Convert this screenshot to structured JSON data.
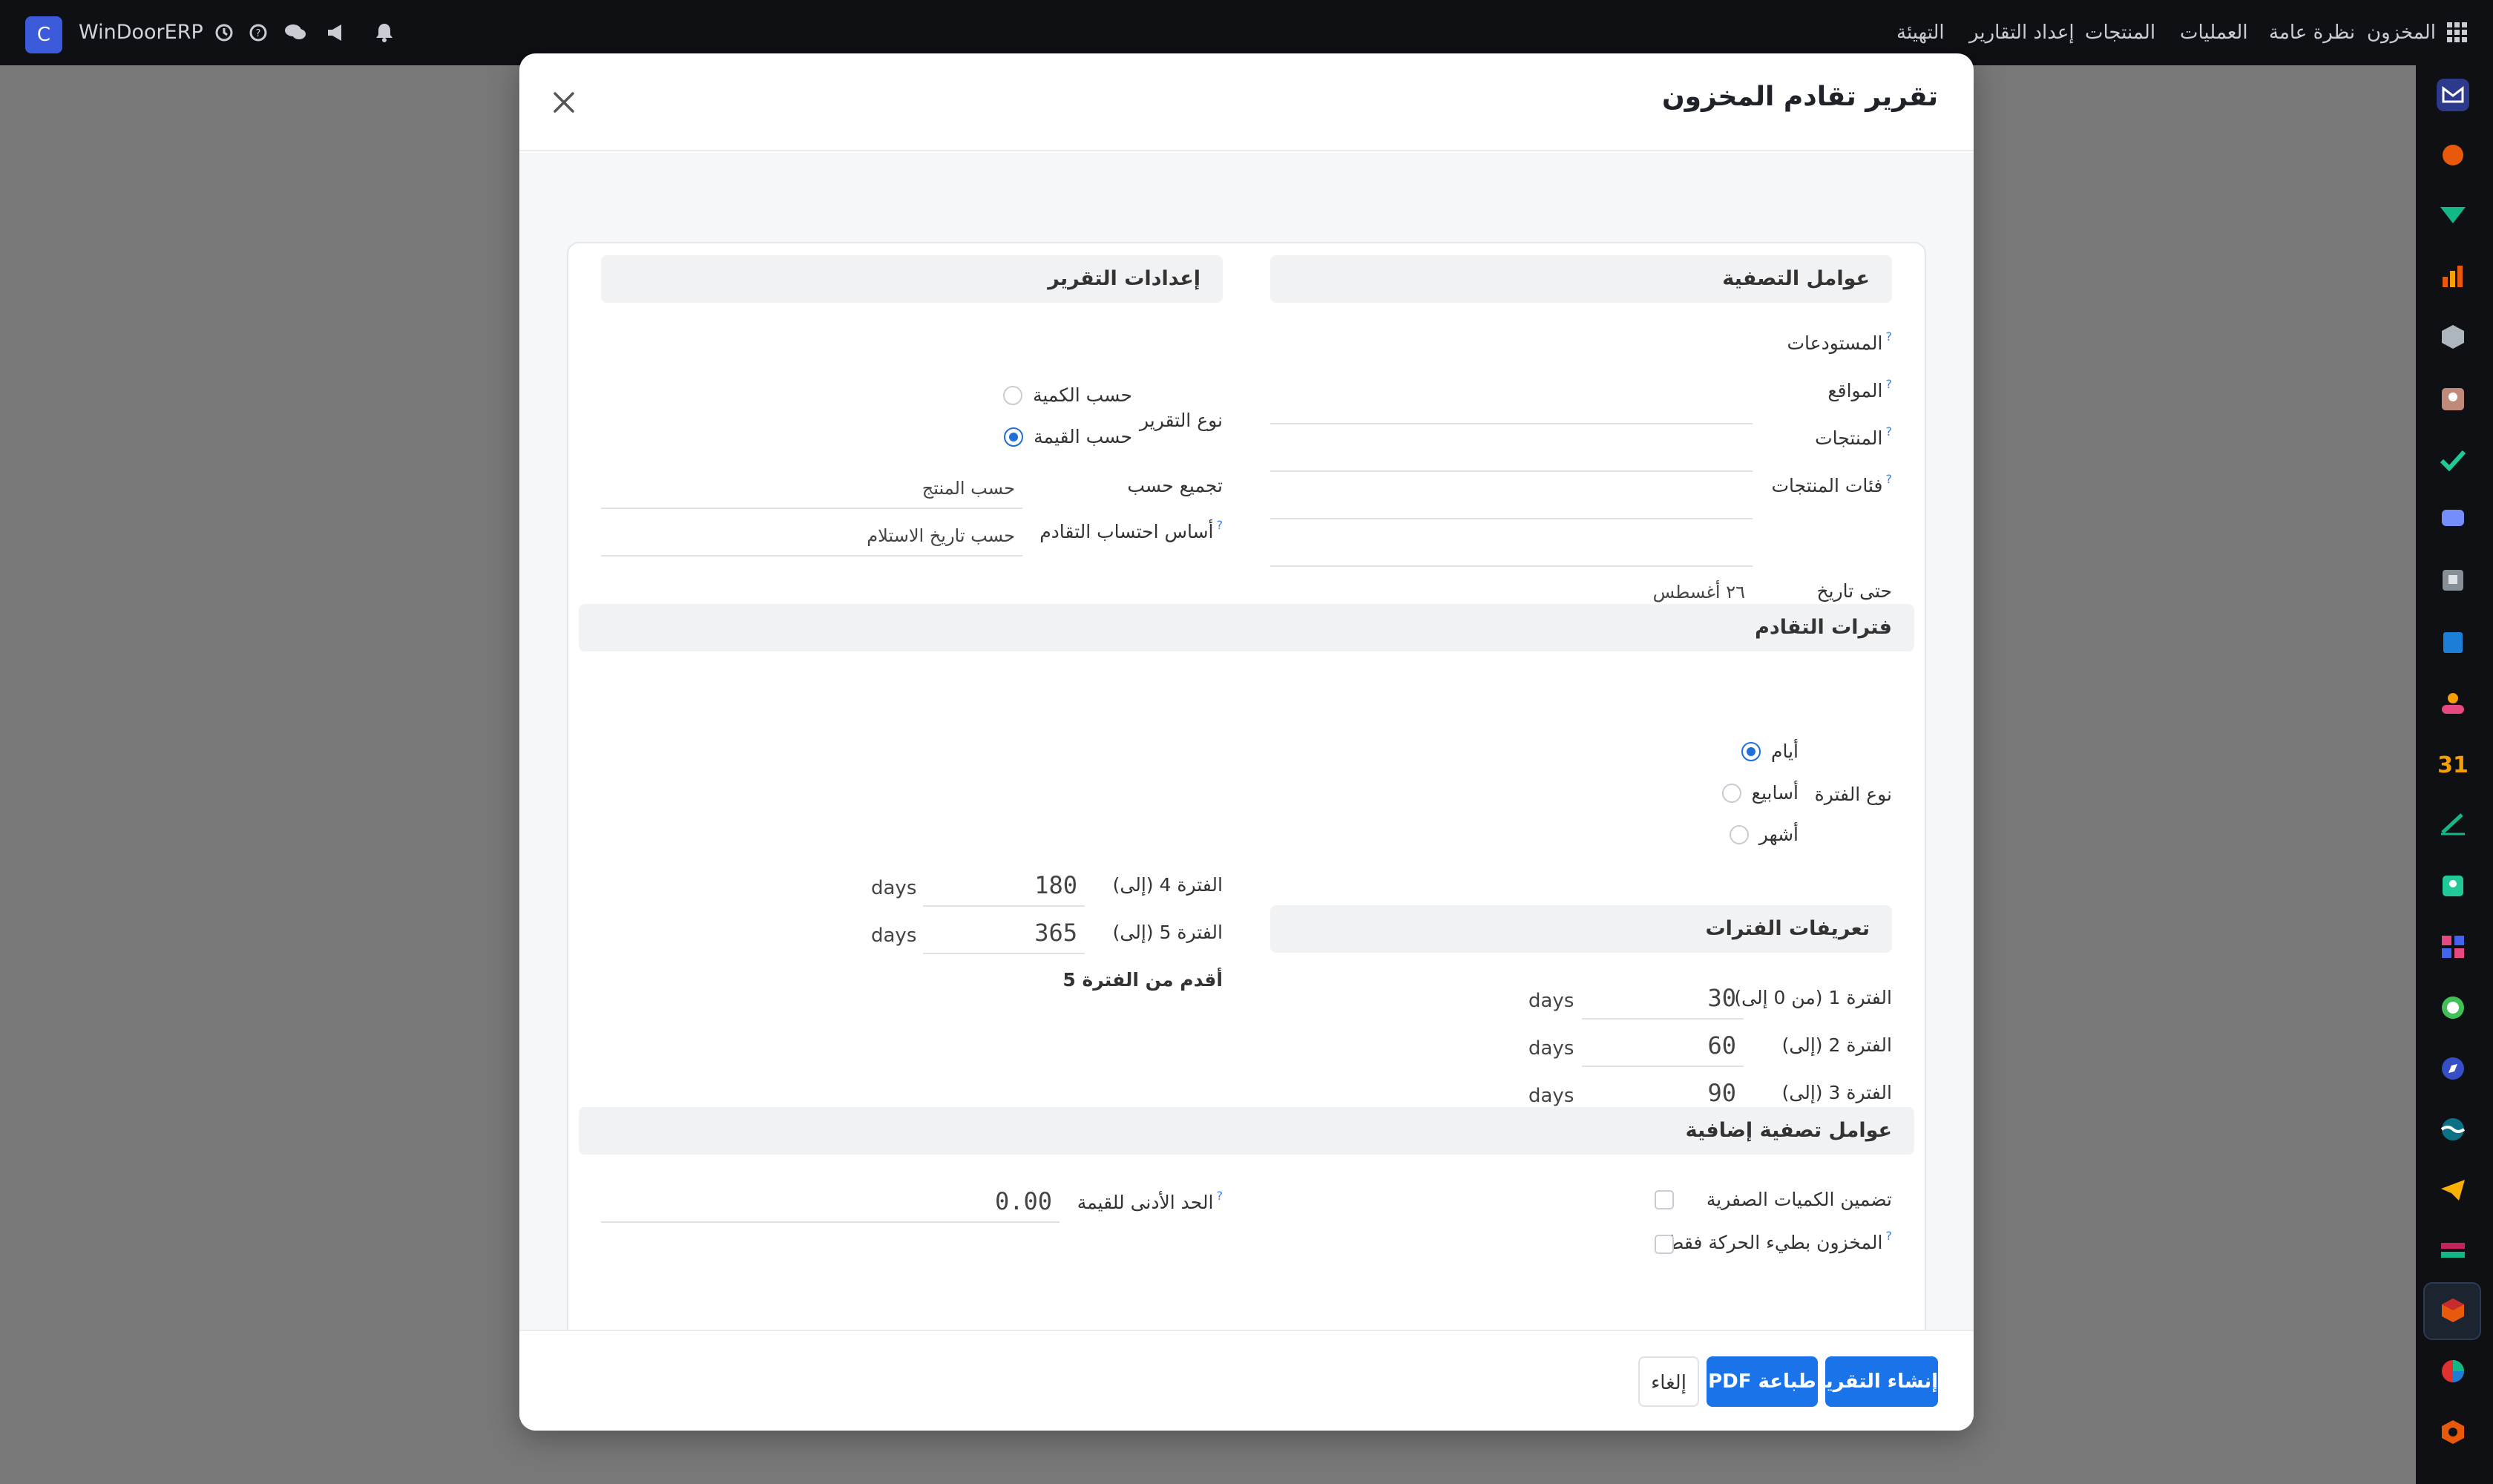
{
  "navbar": {
    "brand": "WinDoorERP",
    "brand_logo_letter": "C",
    "menu": [
      "المخزون",
      "نظرة عامة",
      "العمليات",
      "المنتجات",
      "إعداد التقارير",
      "التهيئة"
    ]
  },
  "modal": {
    "title": "تقرير تقادم المخزون",
    "filters": {
      "title": "عوامل التصفية",
      "warehouses_label": "المستودعات",
      "locations_label": "المواقع",
      "products_label": "المنتجات",
      "categories_label": "فئات المنتجات",
      "date_label": "حتى تاريخ",
      "date_value": "٢٦ أغسطس",
      "help_mark": "?"
    },
    "settings": {
      "title": "إعدادات التقرير",
      "report_type_label": "نوع التقرير",
      "by_quantity": "حسب الكمية",
      "by_value": "حسب القيمة",
      "group_by_label": "تجميع حسب",
      "group_by_value": "حسب المنتج",
      "basis_label": "أساس احتساب التقادم",
      "basis_value": "حسب تاريخ الاستلام"
    },
    "periods": {
      "title": "فترات التقادم",
      "period_type_label": "نوع الفترة",
      "days": "أيام",
      "weeks": "أسابيع",
      "months": "أشهر",
      "definitions_title": "تعريفات الفترات",
      "p1_label": "الفترة 1 (من 0 إلى)",
      "p1_value": "30",
      "p2_label": "الفترة 2 (إلى)",
      "p2_value": "60",
      "p3_label": "الفترة 3 (إلى)",
      "p3_value": "90",
      "p4_label": "الفترة 4 (إلى)",
      "p4_value": "180",
      "p5_label": "الفترة 5 (إلى)",
      "p5_value": "365",
      "older_label": "أقدم من الفترة 5",
      "unit": "days"
    },
    "extra": {
      "title": "عوامل تصفية إضافية",
      "zero_qty_label": "تضمين الكميات الصفرية",
      "slow_moving_label": "المخزون بطيء الحركة فقط",
      "min_value_label": "الحد الأدنى للقيمة",
      "min_value": "0.00"
    },
    "footer": {
      "generate": "إنشاء التقرير",
      "print_pdf": "طباعة PDF",
      "cancel": "إلغاء"
    }
  },
  "colors": {
    "primary": "#1a73e8",
    "navbar_bg": "#0f1014",
    "backdrop": "#787878"
  }
}
